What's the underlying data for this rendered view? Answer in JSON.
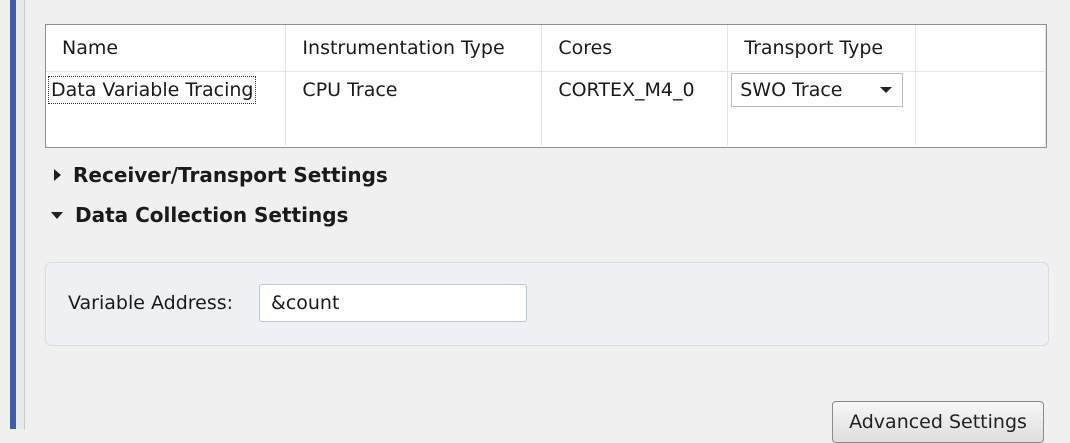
{
  "table": {
    "headers": [
      "Name",
      "Instrumentation Type",
      "Cores",
      "Transport Type"
    ],
    "rows": [
      {
        "name": "Data Variable Tracing",
        "instrumentation_type": "CPU Trace",
        "cores": "CORTEX_M4_0",
        "transport_type": "SWO Trace"
      }
    ]
  },
  "sections": {
    "receiver_transport": "Receiver/Transport Settings",
    "data_collection": "Data Collection Settings"
  },
  "variable": {
    "label": "Variable Address:",
    "value": "&count"
  },
  "buttons": {
    "advanced": "Advanced Settings"
  }
}
